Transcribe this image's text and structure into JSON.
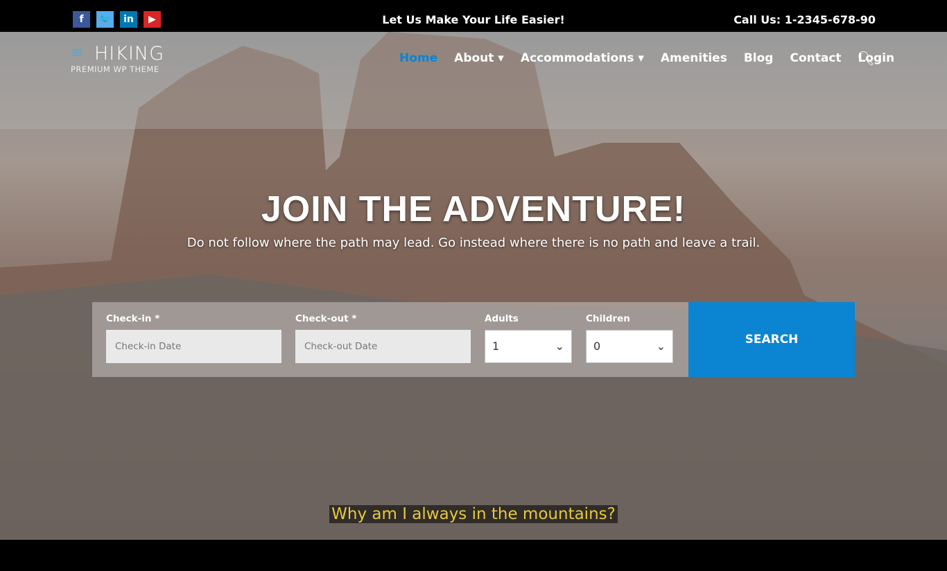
{
  "topbar": {
    "social": [
      {
        "name": "facebook",
        "glyph": "f",
        "color": "#3b5998"
      },
      {
        "name": "twitter",
        "glyph": "t",
        "color": "#55acee"
      },
      {
        "name": "linkedin",
        "glyph": "in",
        "color": "#0077b5"
      },
      {
        "name": "youtube",
        "glyph": "▶",
        "color": "#d82624"
      }
    ],
    "tagline": "Let Us Make Your Life Easier!",
    "call": "Call Us: 1-2345-678-90"
  },
  "logo": {
    "title": "HIKING",
    "subtitle": "PREMIUM WP THEME"
  },
  "nav": {
    "items": [
      "Home",
      "About",
      "Accommodations",
      "Amenities",
      "Blog",
      "Contact",
      "Login"
    ],
    "active": "Home",
    "accent": "#0b85d2"
  },
  "hero": {
    "title": "JOIN THE ADVENTURE!",
    "subtitle": "Do not follow where the path may lead. Go instead where there is no path and leave a trail."
  },
  "form": {
    "checkin_label": "Check-in",
    "checkin_placeholder": "Check-in Date",
    "checkout_label": "Check-out",
    "checkout_placeholder": "Check-out Date",
    "required": "*",
    "adults_label": "Adults",
    "adults_value": "1",
    "children_label": "Children",
    "children_value": "0",
    "search_label": "SEARCH"
  },
  "caption": "Why am I always in the mountains?"
}
